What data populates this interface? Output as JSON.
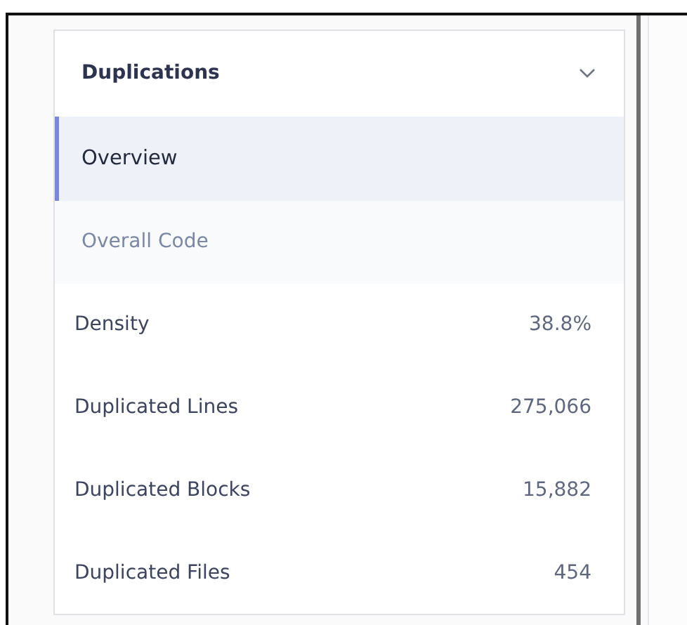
{
  "section": {
    "title": "Duplications",
    "expanded": true
  },
  "nav_items": [
    {
      "label": "Overview",
      "selected": true
    }
  ],
  "group_label": "Overall Code",
  "metrics": [
    {
      "label": "Density",
      "value": "38.8%"
    },
    {
      "label": "Duplicated Lines",
      "value": "275,066"
    },
    {
      "label": "Duplicated Blocks",
      "value": "15,882"
    },
    {
      "label": "Duplicated Files",
      "value": "454"
    }
  ]
}
